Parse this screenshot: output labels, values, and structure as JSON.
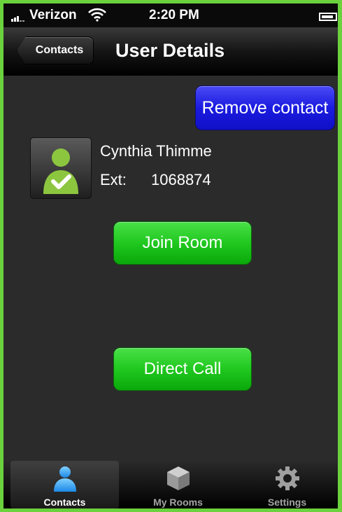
{
  "status_bar": {
    "carrier": "Verizon",
    "time": "2:20 PM"
  },
  "nav_bar": {
    "back_label": "Contacts",
    "title": "User Details"
  },
  "actions": {
    "remove_label": "Remove contact",
    "join_label": "Join Room",
    "direct_call_label": "Direct Call"
  },
  "contact": {
    "name": "Cynthia Thimme",
    "ext_label": "Ext:",
    "ext_value": "1068874"
  },
  "tab_bar": {
    "tabs": [
      {
        "label": "Contacts",
        "icon": "person-icon",
        "active": true
      },
      {
        "label": "My Rooms",
        "icon": "cube-icon",
        "active": false
      },
      {
        "label": "Settings",
        "icon": "gear-icon",
        "active": false
      }
    ]
  },
  "colors": {
    "frame_border": "#6bd13d",
    "background": "#2b2b2b",
    "remove_button": "#1b1be0",
    "action_button": "#20c81f",
    "contact_active_icon": "#3fa9f5"
  }
}
